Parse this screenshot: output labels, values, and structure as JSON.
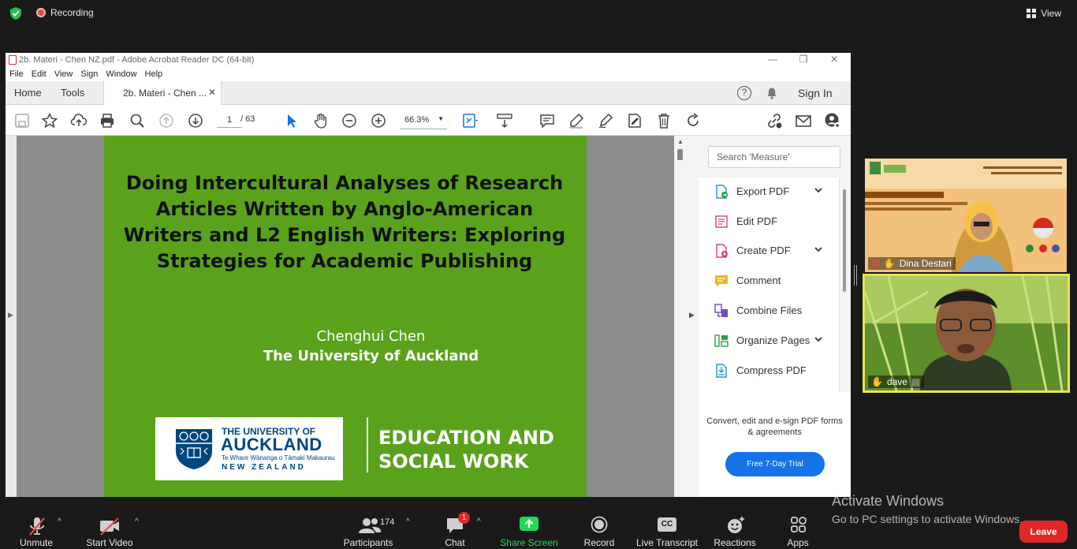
{
  "zoom": {
    "recording_label": "Recording",
    "view_label": "View",
    "toolbar": {
      "unmute": "Unmute",
      "start_video": "Start Video",
      "participants": "Participants",
      "participants_count": "174",
      "chat": "Chat",
      "chat_badge": "1",
      "share_screen": "Share Screen",
      "record": "Record",
      "live_transcript": "Live Transcript",
      "cc_label": "CC",
      "reactions": "Reactions",
      "apps": "Apps",
      "leave": "Leave"
    },
    "participants_videos": [
      {
        "name": "Dina Destari"
      },
      {
        "name": "dave"
      }
    ],
    "colors": {
      "record_dot": "#e5474b",
      "share_green": "#23d959",
      "leave_red": "#e02828",
      "active_speaker": "#e8e25a"
    }
  },
  "acrobat": {
    "window_title": "2b. Materi - Chen NZ.pdf - Adobe Acrobat Reader DC (64-bit)",
    "menu": [
      "File",
      "Edit",
      "View",
      "Sign",
      "Window",
      "Help"
    ],
    "tabs": {
      "home": "Home",
      "tools": "Tools",
      "document": "2b. Materi - Chen ..."
    },
    "sign_in": "Sign In",
    "page_current": "1",
    "page_total": "/   63",
    "zoom_level": "66.3%",
    "right_pane": {
      "search_placeholder": "Search 'Measure'",
      "tools": [
        {
          "label": "Export PDF",
          "expandable": true
        },
        {
          "label": "Edit PDF",
          "expandable": false
        },
        {
          "label": "Create PDF",
          "expandable": true
        },
        {
          "label": "Comment",
          "expandable": false
        },
        {
          "label": "Combine Files",
          "expandable": false
        },
        {
          "label": "Organize Pages",
          "expandable": true
        },
        {
          "label": "Compress PDF",
          "expandable": false
        }
      ],
      "promo_text": "Convert, edit and e-sign PDF forms & agreements",
      "trial_button": "Free 7-Day Trial"
    }
  },
  "slide": {
    "title": "Doing Intercultural Analyses of Research Articles Written by Anglo-American Writers and L2 English Writers:  Exploring Strategies for Academic Publishing",
    "author": "Chenghui  Chen",
    "affiliation": "The University of Auckland",
    "logo": {
      "line1": "THE UNIVERSITY OF",
      "line2": "AUCKLAND",
      "line3": "Te Whare Wānanga o Tāmaki Makaurau",
      "line4": "NEW ZEALAND"
    },
    "faculty_line1": "EDUCATION AND",
    "faculty_line2": "SOCIAL WORK",
    "background": "#5aa21c"
  },
  "windows_watermark": {
    "line1": "Activate Windows",
    "line2": "Go to PC settings to activate Windows."
  }
}
